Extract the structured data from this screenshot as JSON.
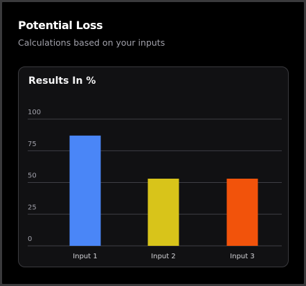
{
  "header": {
    "title": "Potential Loss",
    "subtitle": "Calculations based on your inputs"
  },
  "card": {
    "title": "Results In %"
  },
  "colors": {
    "background": "#000000",
    "card_background": "#111113",
    "card_border": "#3b3b3f",
    "grid": "#3f3f46"
  },
  "chart_data": {
    "type": "bar",
    "categories": [
      "Input 1",
      "Input 2",
      "Input 3"
    ],
    "values": [
      87,
      53,
      53
    ],
    "colors": [
      "#4a86f7",
      "#d8c41a",
      "#f2530b"
    ],
    "title": "",
    "xlabel": "",
    "ylabel": "",
    "ylim": [
      0,
      100
    ],
    "yticks": [
      "100",
      "75",
      "50",
      "25",
      "0"
    ],
    "grid": true,
    "legend": "none"
  }
}
